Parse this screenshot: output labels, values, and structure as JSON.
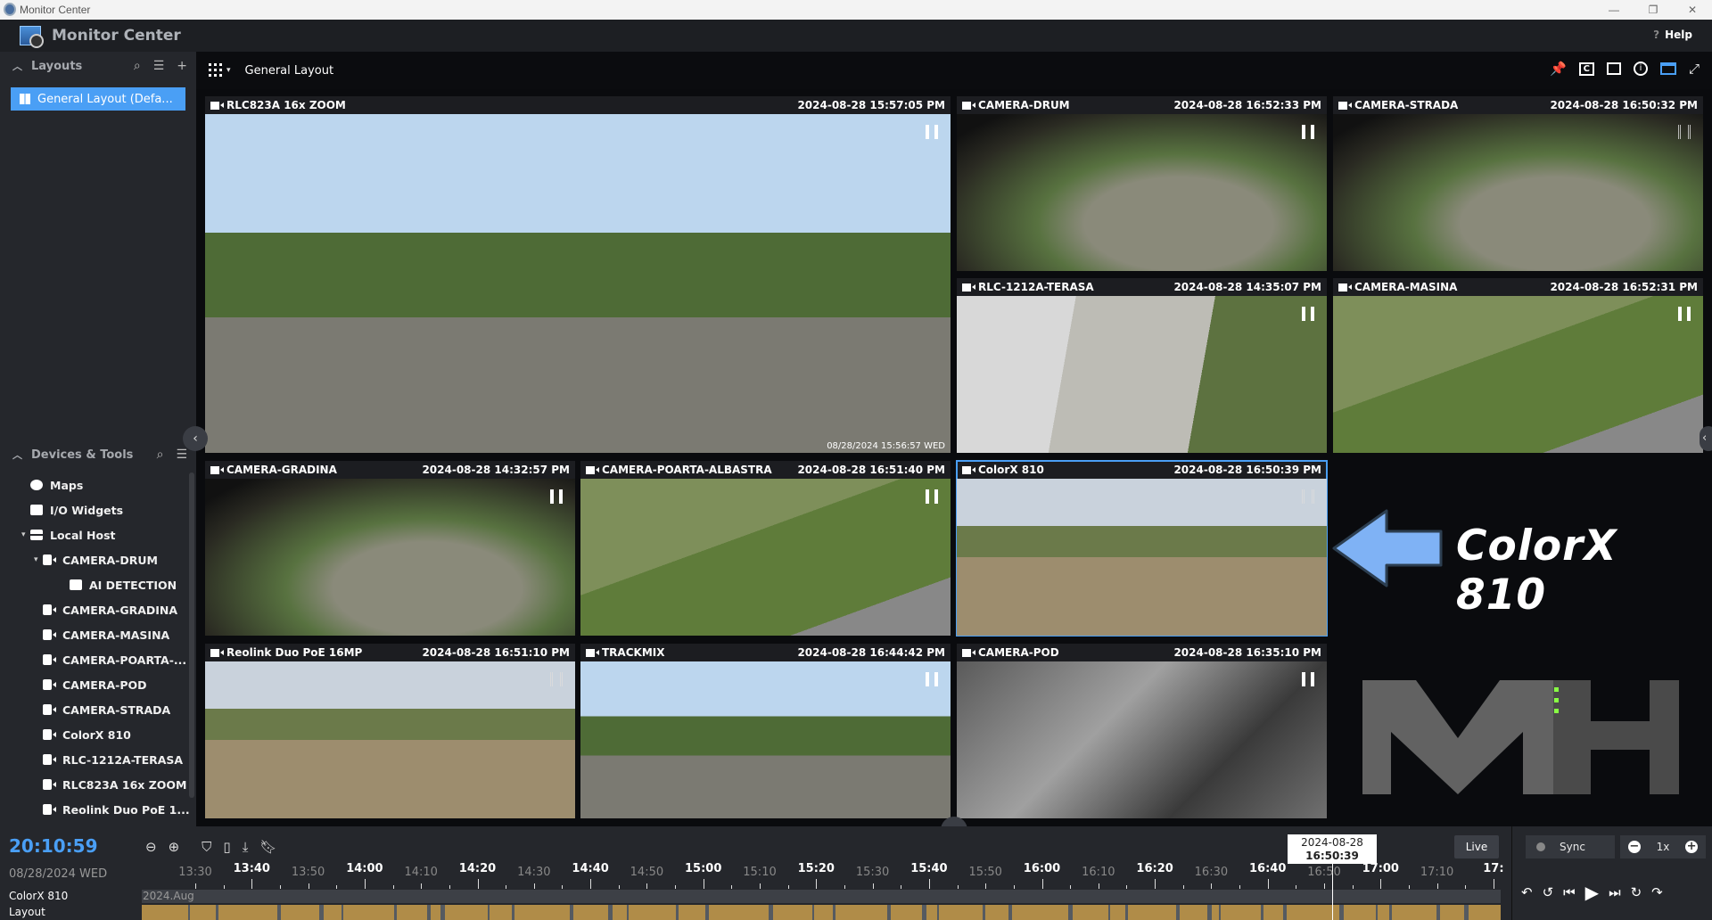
{
  "window": {
    "title": "Monitor Center"
  },
  "app": {
    "title": "Monitor Center",
    "help": "Help"
  },
  "layouts": {
    "header": "Layouts",
    "items": [
      {
        "label": "General Layout (Defa..."
      }
    ]
  },
  "devices": {
    "header": "Devices & Tools",
    "items": [
      {
        "label": "Maps",
        "icon": "globe-icon",
        "level": 1
      },
      {
        "label": "I/O Widgets",
        "icon": "io-widget-icon",
        "level": 1
      },
      {
        "label": "Local Host",
        "icon": "server-icon",
        "level": 1,
        "expanded": true
      },
      {
        "label": "CAMERA-DRUM",
        "icon": "camera-icon",
        "level": 2,
        "expanded": true
      },
      {
        "label": "AI DETECTION",
        "icon": "ai-detection-icon",
        "level": 3
      },
      {
        "label": "CAMERA-GRADINA",
        "icon": "camera-icon",
        "level": 2
      },
      {
        "label": "CAMERA-MASINA",
        "icon": "camera-icon",
        "level": 2
      },
      {
        "label": "CAMERA-POARTA-...",
        "icon": "camera-icon",
        "level": 2
      },
      {
        "label": "CAMERA-POD",
        "icon": "camera-icon",
        "level": 2
      },
      {
        "label": "CAMERA-STRADA",
        "icon": "camera-icon",
        "level": 2
      },
      {
        "label": "ColorX 810",
        "icon": "camera-icon",
        "level": 2
      },
      {
        "label": "RLC-1212A-TERASA",
        "icon": "camera-icon",
        "level": 2
      },
      {
        "label": "RLC823A 16x ZOOM",
        "icon": "camera-icon",
        "level": 2
      },
      {
        "label": "Reolink Duo PoE 1...",
        "icon": "camera-icon",
        "level": 2
      }
    ]
  },
  "toolbar": {
    "layout_name": "General Layout"
  },
  "tiles": [
    {
      "name": "RLC823A 16x ZOOM",
      "time": "2024-08-28 15:57:05 PM",
      "overlay": "08/28/2024 15:56:57 WED",
      "scene": "yard"
    },
    {
      "name": "CAMERA-DRUM",
      "time": "2024-08-28 16:52:33 PM",
      "scene": "fisheye"
    },
    {
      "name": "CAMERA-STRADA",
      "time": "2024-08-28 16:50:32 PM",
      "scene": "fisheye"
    },
    {
      "name": "RLC-1212A-TERASA",
      "time": "2024-08-28 14:35:07 PM",
      "scene": "terrace"
    },
    {
      "name": "CAMERA-MASINA",
      "time": "2024-08-28 16:52:31 PM",
      "scene": "grass"
    },
    {
      "name": "CAMERA-GRADINA",
      "time": "2024-08-28 14:32:57 PM",
      "scene": "fisheye"
    },
    {
      "name": "CAMERA-POARTA-ALBASTRA",
      "time": "2024-08-28 16:51:40 PM",
      "scene": "grass"
    },
    {
      "name": "ColorX 810",
      "time": "2024-08-28 16:50:39 PM",
      "scene": "field",
      "selected": true
    },
    {
      "name": "Reolink Duo PoE 16MP",
      "time": "2024-08-28 16:51:10 PM",
      "scene": "field"
    },
    {
      "name": "TRACKMIX",
      "time": "2024-08-28 16:44:42 PM",
      "scene": "yard"
    },
    {
      "name": "CAMERA-POD",
      "time": "2024-08-28 16:35:10 PM",
      "scene": "attic"
    }
  ],
  "promo": {
    "text": "ColorX 810",
    "arrow_color": "#7fb2f5",
    "logo": "MH"
  },
  "timeline": {
    "clock": "20:10:59",
    "date": "08/28/2024 WED",
    "ticks": [
      "13:30",
      "13:40",
      "13:50",
      "14:00",
      "14:10",
      "14:20",
      "14:30",
      "14:40",
      "14:50",
      "15:00",
      "15:10",
      "15:20",
      "15:30",
      "15:40",
      "15:50",
      "16:00",
      "16:10",
      "16:20",
      "16:30",
      "16:40",
      "16:50",
      "17:00",
      "17:10",
      "17:"
    ],
    "cursor_date": "2024-08-28",
    "cursor_time": "16:50:39",
    "tracks": [
      {
        "label": "ColorX 810",
        "sublabel": "2024.Aug"
      },
      {
        "label": "Layout"
      }
    ],
    "live": "Live",
    "sync": "Sync",
    "speed": "1x",
    "recording_color": "#b08c48",
    "accent": "#4a9ff5"
  }
}
